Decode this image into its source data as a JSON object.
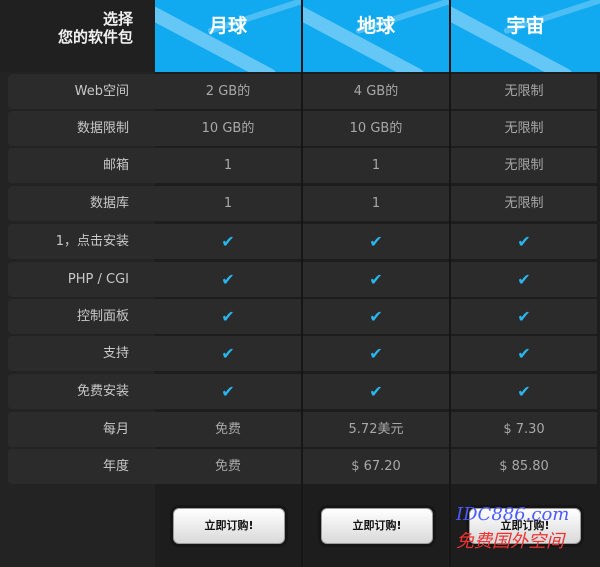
{
  "corner": {
    "line1": "选择",
    "line2": "您的软件包"
  },
  "row_labels": [
    "Web空间",
    "数据限制",
    "邮箱",
    "数据库",
    "1，点击安装",
    "PHP / CGI",
    "控制面板",
    "支持",
    "免费安装",
    "每月",
    "年度"
  ],
  "plans": [
    {
      "name": "月球",
      "cells": [
        "2 GB的",
        "10 GB的",
        "1",
        "1",
        "✔",
        "✔",
        "✔",
        "✔",
        "✔",
        "免费",
        "免费"
      ],
      "button": "立即订购!"
    },
    {
      "name": "地球",
      "cells": [
        "4 GB的",
        "10 GB的",
        "1",
        "1",
        "✔",
        "✔",
        "✔",
        "✔",
        "✔",
        "5.72美元",
        "$ 67.20"
      ],
      "button": "立即订购!"
    },
    {
      "name": "宇宙",
      "cells": [
        "无限制",
        "无限制",
        "无限制",
        "无限制",
        "✔",
        "✔",
        "✔",
        "✔",
        "✔",
        "$ 7.30",
        "$ 85.80"
      ],
      "button": "立即订购!"
    }
  ],
  "watermark": {
    "line1": "IDC886.com",
    "line2": "免费国外空间"
  },
  "colors": {
    "accent": "#11a9f0",
    "check": "#29b6ef",
    "row_bg": "#2b2b2b",
    "page_bg": "#232323"
  }
}
